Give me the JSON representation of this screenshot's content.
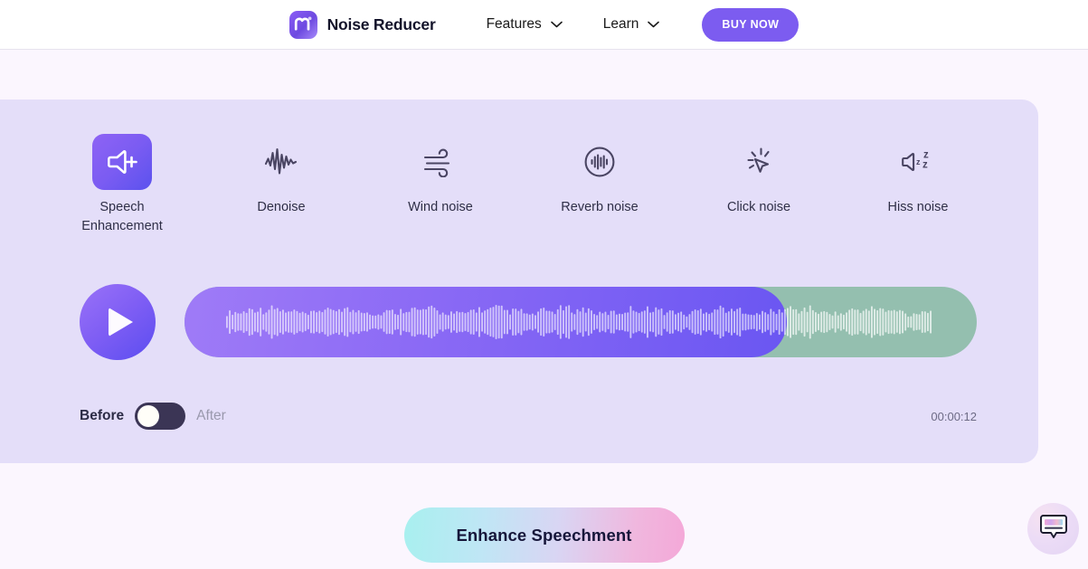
{
  "header": {
    "brand_name": "Noise Reducer",
    "logo_icon": "media-io-m-logo-icon",
    "nav": [
      {
        "label": "Features",
        "icon": "chevron-down-icon"
      },
      {
        "label": "Learn",
        "icon": "chevron-down-icon"
      }
    ],
    "buy_label": "BUY NOW"
  },
  "clipped_text": "",
  "features": [
    {
      "id": "speech-enhancement",
      "label": "Speech\nEnhancement",
      "icon": "speaker-plus-icon",
      "active": true
    },
    {
      "id": "denoise",
      "label": "Denoise",
      "icon": "waveform-spike-icon",
      "active": false
    },
    {
      "id": "wind-noise",
      "label": "Wind noise",
      "icon": "wind-icon",
      "active": false
    },
    {
      "id": "reverb-noise",
      "label": "Reverb noise",
      "icon": "circle-waveform-icon",
      "active": false
    },
    {
      "id": "click-noise",
      "label": "Click noise",
      "icon": "cursor-click-icon",
      "active": false
    },
    {
      "id": "hiss-noise",
      "label": "Hiss noise",
      "icon": "speaker-zzz-icon",
      "active": false
    }
  ],
  "player": {
    "play_icon": "play-icon",
    "state": "paused",
    "progress_percent": 76,
    "timecode": "00:00:12",
    "before_label": "Before",
    "after_label": "After",
    "toggle_state": "before"
  },
  "cta": {
    "label": "Enhance Speechment"
  },
  "chat": {
    "icon": "chat-bubble-icon"
  },
  "colors": {
    "page_bg": "#fbf6fe",
    "panel_bg": "#e4def9",
    "accent_purple": "#7c5cf0",
    "progress_purple": "#7f5ef4",
    "track_green": "#94bfaf",
    "toggle_track": "#3b3555",
    "text_dark": "#2b2b45",
    "text_muted": "#9a99ad"
  }
}
